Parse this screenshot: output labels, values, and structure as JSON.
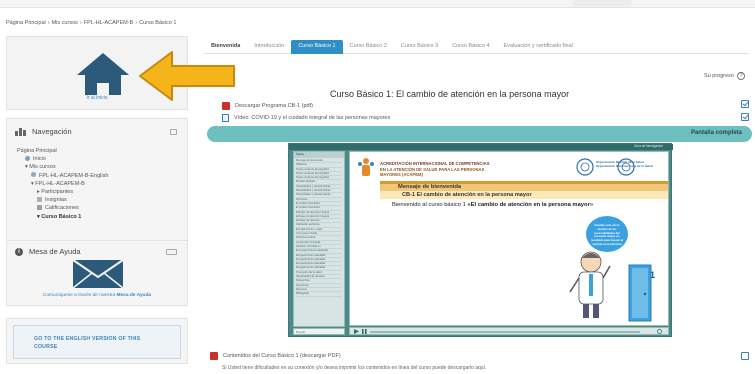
{
  "breadcrumb": [
    "Página Principal",
    "›",
    "Mis cursos",
    "›",
    "FPL-HL-ACAPEM-B",
    "›",
    "Curso Básico 1"
  ],
  "home_block": {
    "label": "Ir al inicio"
  },
  "navigation": {
    "title": "Navegación",
    "items": [
      {
        "label": "Página Principal",
        "level": 0
      },
      {
        "label": "Inicio",
        "level": 1
      },
      {
        "label": "Mis cursos",
        "level": 1
      },
      {
        "label": "FPL-HL-ACAPEM-B-English",
        "level": 2
      },
      {
        "label": "FPL-HL-ACAPEM-B",
        "level": 2
      },
      {
        "label": "Participantes",
        "level": 3
      },
      {
        "label": "Insignias",
        "level": 3
      },
      {
        "label": "Calificaciones",
        "level": 3
      },
      {
        "label": "Curso Básico 1",
        "level": 3
      }
    ]
  },
  "help_block": {
    "title": "Mesa de Ayuda",
    "text_prefix": "Comuníquese a través de nuestra",
    "text_link": "Mesa de Ayuda"
  },
  "english_block": {
    "line1": "GO TO THE ENGLISH VERSION OF THIS",
    "line2": "COURSE"
  },
  "tabs": [
    {
      "label": "Bienvenida",
      "state": "bold"
    },
    {
      "label": "Introducción",
      "state": "normal"
    },
    {
      "label": "Curso Básico 1",
      "state": "active"
    },
    {
      "label": "Curso Básico 2",
      "state": "normal"
    },
    {
      "label": "Curso Básico 3",
      "state": "normal"
    },
    {
      "label": "Curso Básico 4",
      "state": "normal"
    },
    {
      "label": "Evaluación y certificado final",
      "state": "normal"
    }
  ],
  "progress_label": "Su progreso",
  "course_title": "Curso Básico 1: El cambio de atención en la persona mayor",
  "activities": [
    {
      "label": "Descargar Programa CB-1 (pdf)"
    },
    {
      "label": "Vídeo: COVID-19 y el cuidado integral de las personas mayores"
    }
  ],
  "fullscreen_label": "Pantalla completa",
  "player": {
    "top_label": "Guía de Navegación",
    "toc_head": "Índice",
    "toc_items": [
      "Mensaje de bienvenida",
      "Objetivos",
      "Nuevo contexto demográfico",
      "Nuevo contexto demográfico",
      "Nuevo contexto demográfico",
      "Desafío sanitario",
      "Necesidades y características",
      "Necesidades y características",
      "Necesidades y características",
      "Personas...",
      "El modelo biomédico",
      "El modelo biomédico",
      "Enfoque de atención integral",
      "Enfoque de atención integral",
      "Enfoque de atención",
      "Valoración geriátrica",
      "Envejecimiento y vejez",
      "Una nueva mirada",
      "Persona-centred",
      "La atención centrada",
      "Atención centrada en",
      "El envejecimiento saludable",
      "Envejecimiento saludable",
      "Envejecimiento saludable",
      "Envejecimiento saludable",
      "Envejecimiento saludable",
      "Promoción de la salud",
      "Necesidades de atención",
      "Perspectiva",
      "Prevención",
      "Resumen",
      "Bibliografía"
    ],
    "search_placeholder": "Buscar",
    "acred_line1": "ACREDITACIÓN INTERNACIONAL DE COMPETENCIAS",
    "acred_line2": "EN LA ATENCIÓN DE SALUD PARA LAS PERSONAS",
    "acred_line3": "MAYORES (ACAPEM)",
    "oms_line1": "Organización Mundial de la Salud",
    "oms_line2": "Organización Panamericana de la Salud",
    "welcome_title": "Mensaje de bienvenida",
    "welcome_sub": "CB-1 El cambio de atención en la persona mayor",
    "welcome_msg_prefix": "Bienvenido al curso básico 1 ",
    "welcome_msg_bold": "«El cambio de atención en la persona mayor»",
    "bubble_text": "Cuando este curso termine de las personalidades del presente mayor un resultado para buscar al sentido en la atención",
    "door_number": "1"
  },
  "contents_label": "Contenidos del Curso Básico 1 (descargar PDF)",
  "note_text": "Si Usted tiene dificultades en su conexión y/o desea imprimir los contenidos en línea del curso puede descargarlo aquí."
}
